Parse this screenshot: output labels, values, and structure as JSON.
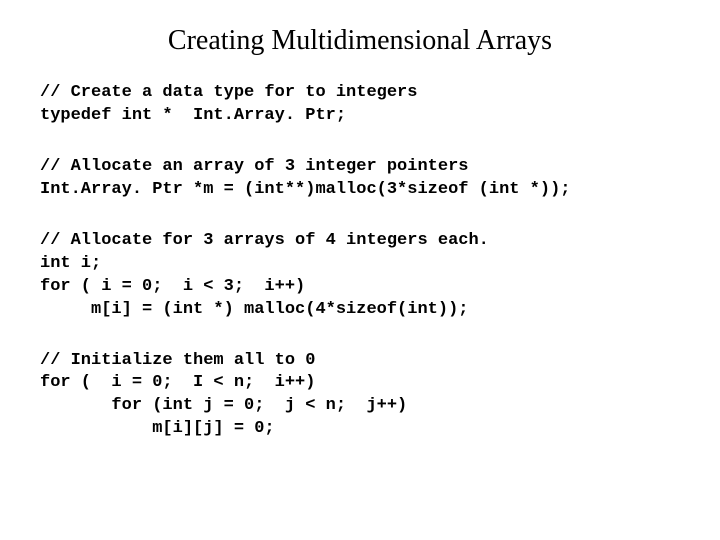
{
  "title": "Creating Multidimensional Arrays",
  "blocks": [
    "// Create a data type for to integers\ntypedef int *  Int.Array. Ptr;",
    "// Allocate an array of 3 integer pointers\nInt.Array. Ptr *m = (int**)malloc(3*sizeof (int *));",
    "// Allocate for 3 arrays of 4 integers each.\nint i;\nfor ( i = 0;  i < 3;  i++)\n     m[i] = (int *) malloc(4*sizeof(int));",
    "// Initialize them all to 0\nfor (  i = 0;  I < n;  i++)\n       for (int j = 0;  j < n;  j++)\n           m[i][j] = 0;"
  ]
}
